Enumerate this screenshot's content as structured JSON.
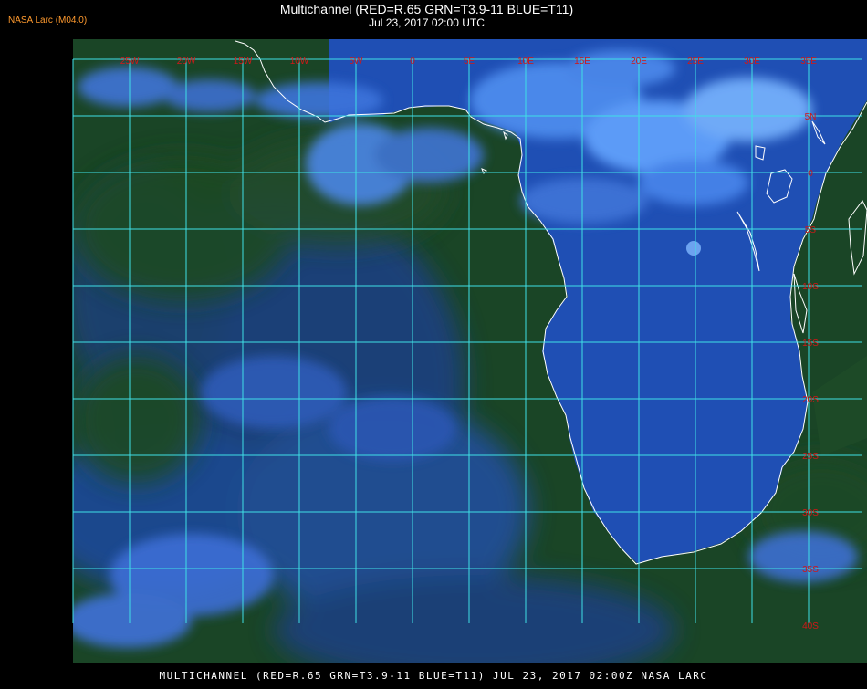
{
  "header": {
    "title": "Multichannel (RED=R.65 GRN=T3.9-11 BLUE=T11)",
    "subtitle": "Jul 23, 2017 02:00 UTC",
    "credit": "NASA Larc (M04.0)"
  },
  "footer": {
    "caption": "MULTICHANNEL (RED=R.65 GRN=T3.9-11 BLUE=T11) JUL 23, 2017 02:00Z    NASA LARC"
  },
  "map": {
    "colors": {
      "grid": "#3fe0e6",
      "coast": "#ffffff",
      "label": "#d01818",
      "ocean": "#1d4a2a",
      "land": "#1d4fb0",
      "cloud": "#5fa8ff"
    },
    "lon_labels": [
      "25W",
      "20W",
      "15W",
      "10W",
      "5W",
      "0",
      "5E",
      "10E",
      "15E",
      "20E",
      "25E",
      "30E",
      "35E"
    ],
    "lat_labels": [
      "5N",
      "0",
      "5S",
      "10S",
      "15S",
      "20S",
      "25S",
      "30S",
      "35S",
      "40S"
    ]
  }
}
